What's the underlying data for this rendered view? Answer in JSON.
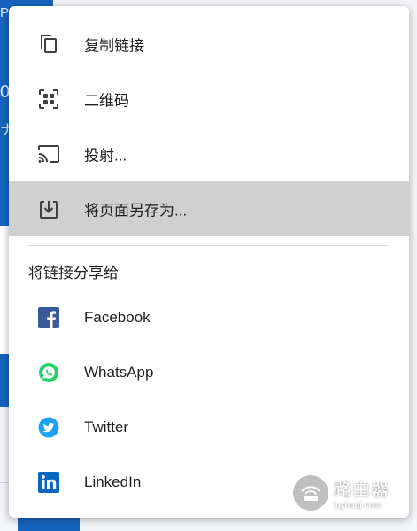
{
  "background": {
    "fragments": [
      "PE",
      "0",
      "ナ"
    ]
  },
  "menu": {
    "items": [
      {
        "label": "复制链接",
        "icon": "copy-icon"
      },
      {
        "label": "二维码",
        "icon": "qr-code-icon"
      },
      {
        "label": "投射...",
        "icon": "cast-icon"
      },
      {
        "label": "将页面另存为...",
        "icon": "save-download-icon",
        "highlighted": true
      }
    ],
    "share_section_title": "将链接分享给",
    "share_items": [
      {
        "label": "Facebook",
        "icon": "facebook-icon",
        "color": "#3b5998"
      },
      {
        "label": "WhatsApp",
        "icon": "whatsapp-icon",
        "color": "#25d366"
      },
      {
        "label": "Twitter",
        "icon": "twitter-icon",
        "color": "#1da1f2"
      },
      {
        "label": "LinkedIn",
        "icon": "linkedin-icon",
        "color": "#0a66c2"
      }
    ]
  },
  "watermark": {
    "main": "路由器",
    "sub": "luyouqi.com"
  },
  "colors": {
    "highlight": "#d0d0d0",
    "text": "#202124",
    "icon": "#3c4043"
  }
}
